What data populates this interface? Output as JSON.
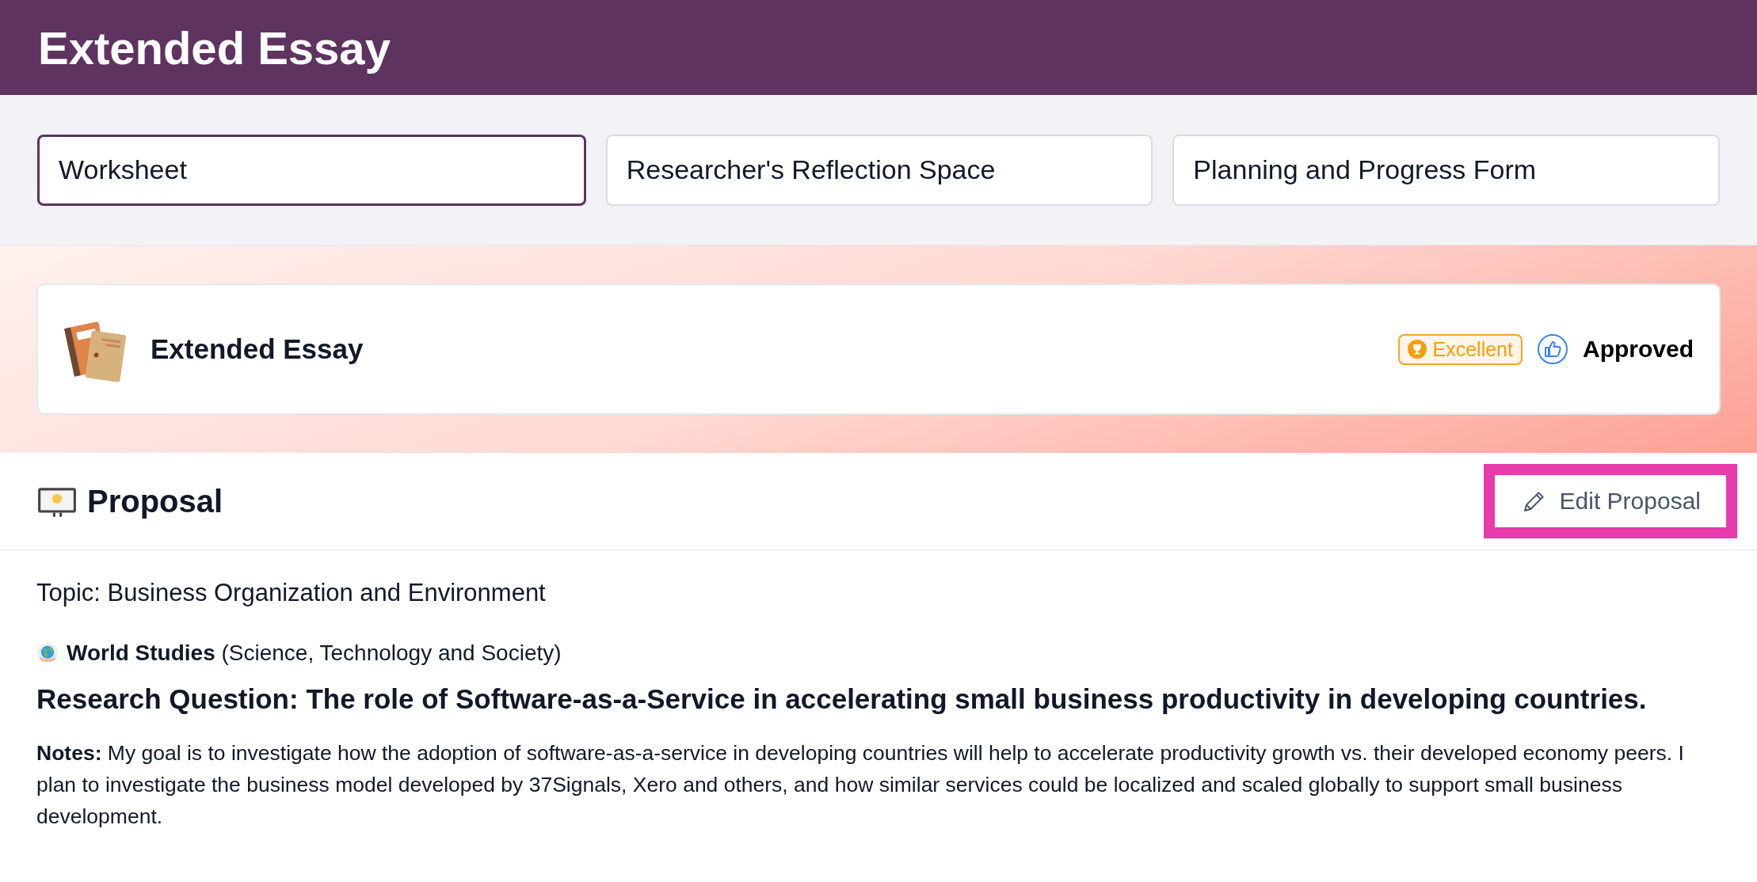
{
  "header": {
    "title": "Extended Essay"
  },
  "tabs": [
    {
      "label": "Worksheet",
      "selected": true
    },
    {
      "label": "Researcher's Reflection Space",
      "selected": false
    },
    {
      "label": "Planning and Progress Form",
      "selected": false
    }
  ],
  "essay_card": {
    "title": "Extended Essay",
    "grade_badge": "Excellent",
    "status": "Approved"
  },
  "proposal": {
    "title": "Proposal",
    "edit_button": {
      "label": "Edit Proposal",
      "highlighted": true
    },
    "topic": "Topic: Business Organization and Environment",
    "subject": "**World Studies** (Science, Technology and Society)",
    "research_question": "Research Question: The role of Software-as-a-Service in accelerating small business productivity in developing countries.",
    "notes": "**Notes:** My goal is to investigate how the adoption of software-as-a-service in developing countries will help to accelerate productivity growth vs. their developed economy peers. I plan to investigate the business model developed by 37Signals, Xero and others, and how similar services could be localized and scaled globally to support small business development."
  }
}
